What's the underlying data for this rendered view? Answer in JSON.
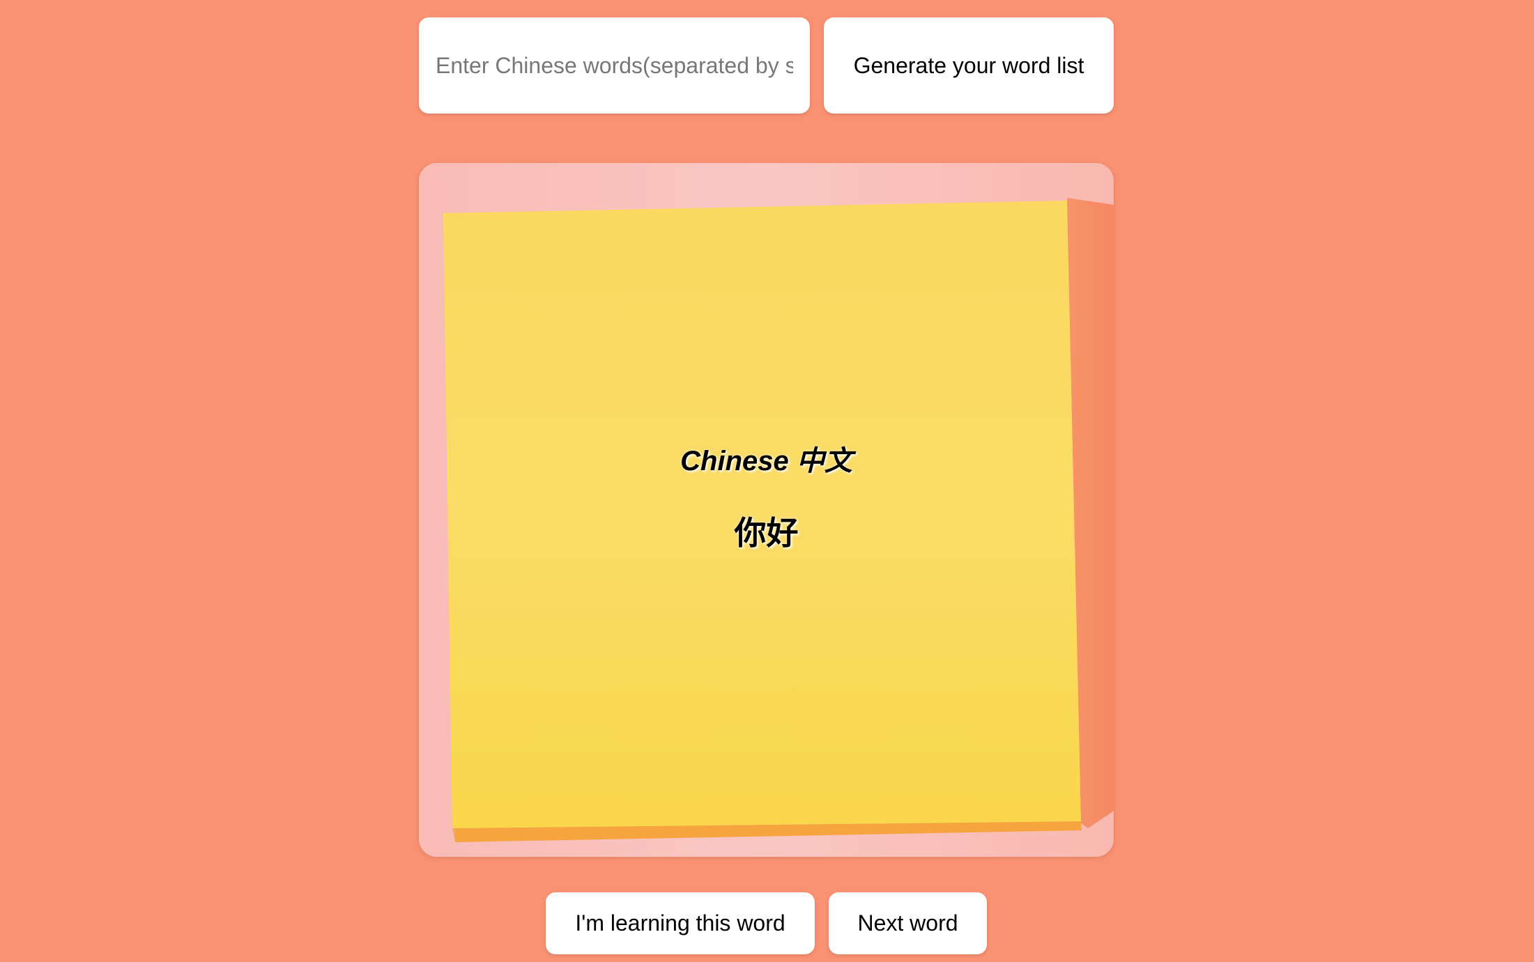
{
  "input": {
    "placeholder": "Enter Chinese words(separated by s",
    "value": ""
  },
  "generate_button": {
    "label": "Generate your word list"
  },
  "card": {
    "language_label": "Chinese 中文",
    "current_word": "你好",
    "background": "sticky-note-image",
    "colors": {
      "card_bg": "#f9c4c0",
      "note_yellow": "#fad85a",
      "note_edge": "#f6a43e"
    }
  },
  "actions": {
    "learning_label": "I'm learning this word",
    "next_label": "Next word"
  },
  "colors": {
    "page_bg": "#fa9172",
    "button_bg": "#ffffff"
  }
}
